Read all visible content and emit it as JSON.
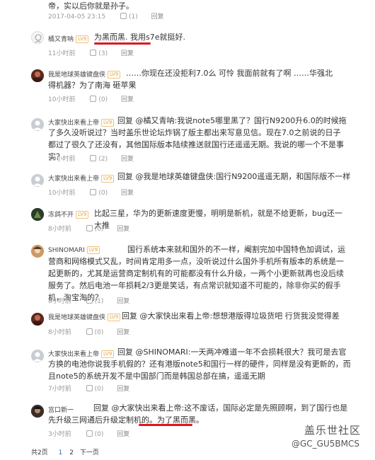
{
  "top": {
    "text": "帝，实以后你就是孙子。",
    "time": "2017-04-05 23:15",
    "likes": "(1)",
    "reply": "回复"
  },
  "comments": [
    {
      "user": "橘又青呐",
      "badge": "LV9",
      "text": "为黑而黑. 我用s7e就挺好.",
      "time": "11小时前",
      "likes": "(3)",
      "reply": "回复"
    },
    {
      "user": "我是地球英雄键盘侠",
      "badge": "LV9",
      "text": "……你现在还没拒利7.0么 可怜 我面前就有了啊 ……华强北得机器？为了南海 砸苹果",
      "time": "10小时前",
      "likes": "(0)",
      "reply": "回复"
    },
    {
      "user": "大家快出来看上帝",
      "badge": "LV9",
      "text": "回复 @橘又青呐:我说note5哪里黑了？国行N9200升6.0的时候拖了多久没听说过？当时盖乐世论坛炸锅了版主都出来写意见信。现在7.0之前说的日子都过了很久了还没有，其他国际版本陆续推送就国行还遥遥无期。我说的哪一个不是事实？",
      "time": "10小时前",
      "likes": "(2)",
      "reply": "回复"
    },
    {
      "user": "大家快出来看上帝",
      "badge": "LV9",
      "text": "回复 @我是地球英雄键盘侠:国行N9200遥遥无期，和国际版不一样",
      "time": "10小时前",
      "likes": "(0)",
      "reply": "回复"
    },
    {
      "user": "冻鸽不开",
      "badge": "LV9",
      "text": "比起三星，华为的更新速度更慢，明明是新机，就是不给更新，bug还一大推",
      "time": "8小时前",
      "likes": "(0)",
      "reply": "回复"
    },
    {
      "user": "SHINOMARI",
      "badge": "LV9",
      "text": "国行系统本来就和国外的不一样，阉割完加中国特色加调试，运营商和网络模式又乱，时间肯定用多一点，没听说过什么国外手机所有版本的系统是一起更新的，尤其是运营商定制机有的可能都没有什么升级，一两个小更新就再也没后续服务了。然后电池一年损耗2/3更是笑话，有点常识就知道不可能的，除非你买的假手机，淘宝淘的？",
      "time": "8小时前",
      "likes": "(1)",
      "reply": "回复"
    },
    {
      "user": "我是地球英雄键盘侠",
      "badge": "LV9",
      "text": "回复 @大家快出来看上帝:想想港版得垃圾货吧 行货我没觉得差",
      "time": "8小时前",
      "likes": "(0)",
      "reply": "回复"
    },
    {
      "user": "大家快出来看上帝",
      "badge": "LV9",
      "text": "回复 @SHINOMARI:一天两冲难道一年不会损耗很大？我可是去官方换的电池你说我手机假的？还有港版note5和国行一样的硬件，同样是没有更新的，而且note5的系统开发不是中国部门而是韩国总部在搞，遥遥无期",
      "time": "7小时前",
      "likes": "(0)",
      "reply": "回复"
    },
    {
      "user": "宫口新一",
      "badge": "LV9",
      "text": "回复 @大家快出来看上帝:这不废话，国际必定是先照顾啊，到了国行也是先升级三网通后升级定制机的。为了黑而黑。",
      "time": "3小时前",
      "likes": "(0)",
      "reply": "回复"
    }
  ],
  "pager": {
    "total": "共2页",
    "current": "1",
    "page2": "2",
    "next": "下一页"
  },
  "watermark": {
    "line1": "盖乐世社区",
    "line2": "@GC_GU5BMCS"
  },
  "colors": {
    "underline": "#e0161c",
    "link_blue": "#2a6ebb",
    "vip_badge": "#e9a23b"
  }
}
